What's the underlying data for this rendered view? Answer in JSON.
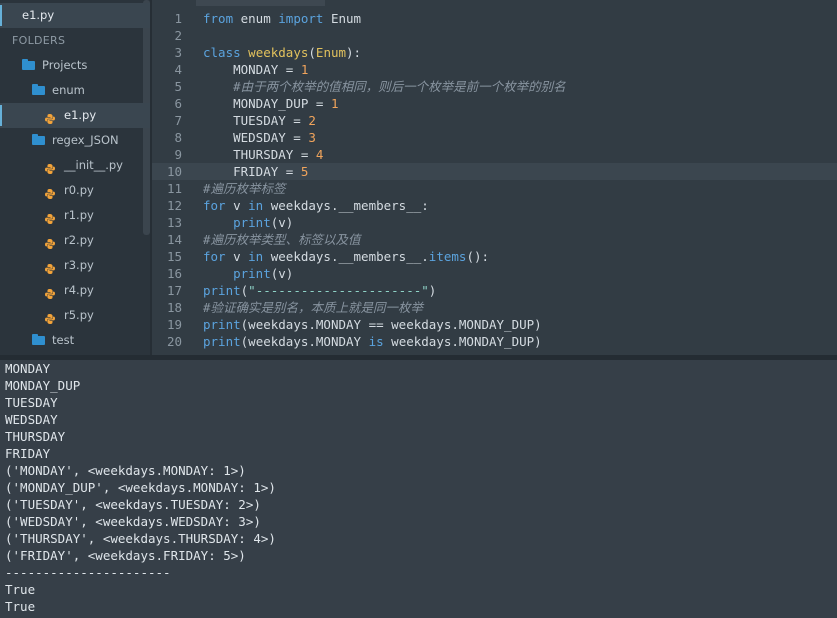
{
  "sidebar": {
    "open_file": "e1.py",
    "folders_header": "FOLDERS",
    "tree": [
      {
        "label": "Projects",
        "type": "folder"
      },
      {
        "label": "enum",
        "type": "folder"
      },
      {
        "label": "e1.py",
        "type": "python"
      },
      {
        "label": "regex_JSON",
        "type": "folder"
      },
      {
        "label": "__init__.py",
        "type": "python"
      },
      {
        "label": "r0.py",
        "type": "python"
      },
      {
        "label": "r1.py",
        "type": "python"
      },
      {
        "label": "r2.py",
        "type": "python"
      },
      {
        "label": "r3.py",
        "type": "python"
      },
      {
        "label": "r4.py",
        "type": "python"
      },
      {
        "label": "r5.py",
        "type": "python"
      },
      {
        "label": "test",
        "type": "folder"
      }
    ]
  },
  "editor": {
    "current_line": 10,
    "lines": [
      {
        "n": "1",
        "t": [
          [
            "kw",
            "from"
          ],
          [
            "op",
            " enum "
          ],
          [
            "kw",
            "import"
          ],
          [
            "op",
            " Enum"
          ]
        ]
      },
      {
        "n": "2",
        "t": []
      },
      {
        "n": "3",
        "t": [
          [
            "kw",
            "class"
          ],
          [
            "op",
            " "
          ],
          [
            "cls",
            "weekdays"
          ],
          [
            "op",
            "("
          ],
          [
            "cls",
            "Enum"
          ],
          [
            "op",
            "):"
          ]
        ]
      },
      {
        "n": "4",
        "t": [
          [
            "op",
            "    MONDAY = "
          ],
          [
            "num",
            "1"
          ]
        ]
      },
      {
        "n": "5",
        "t": [
          [
            "op",
            "    "
          ],
          [
            "cmt",
            "#由于两个枚举的值相同，则后一个枚举是前一个枚举的别名"
          ]
        ]
      },
      {
        "n": "6",
        "t": [
          [
            "op",
            "    MONDAY_DUP = "
          ],
          [
            "num",
            "1"
          ]
        ]
      },
      {
        "n": "7",
        "t": [
          [
            "op",
            "    TUESDAY = "
          ],
          [
            "num",
            "2"
          ]
        ]
      },
      {
        "n": "8",
        "t": [
          [
            "op",
            "    WEDSDAY = "
          ],
          [
            "num",
            "3"
          ]
        ]
      },
      {
        "n": "9",
        "t": [
          [
            "op",
            "    THURSDAY = "
          ],
          [
            "num",
            "4"
          ]
        ]
      },
      {
        "n": "10",
        "t": [
          [
            "op",
            "    FRIDAY = "
          ],
          [
            "num",
            "5"
          ]
        ]
      },
      {
        "n": "11",
        "t": [
          [
            "cmt",
            "#遍历枚举标签"
          ]
        ]
      },
      {
        "n": "12",
        "t": [
          [
            "kw",
            "for"
          ],
          [
            "op",
            " v "
          ],
          [
            "kw",
            "in"
          ],
          [
            "op",
            " weekdays.__members__:"
          ]
        ]
      },
      {
        "n": "13",
        "t": [
          [
            "op",
            "    "
          ],
          [
            "fn",
            "print"
          ],
          [
            "op",
            "(v)"
          ]
        ]
      },
      {
        "n": "14",
        "t": [
          [
            "cmt",
            "#遍历枚举类型、标签以及值"
          ]
        ]
      },
      {
        "n": "15",
        "t": [
          [
            "kw",
            "for"
          ],
          [
            "op",
            " v "
          ],
          [
            "kw",
            "in"
          ],
          [
            "op",
            " weekdays.__members__."
          ],
          [
            "meth",
            "items"
          ],
          [
            "op",
            "():"
          ]
        ]
      },
      {
        "n": "16",
        "t": [
          [
            "op",
            "    "
          ],
          [
            "fn",
            "print"
          ],
          [
            "op",
            "(v)"
          ]
        ]
      },
      {
        "n": "17",
        "t": [
          [
            "fn",
            "print"
          ],
          [
            "op",
            "("
          ],
          [
            "str",
            "\"----------------------\""
          ],
          [
            "op",
            ")"
          ]
        ]
      },
      {
        "n": "18",
        "t": [
          [
            "cmt",
            "#验证确实是别名，本质上就是同一枚举"
          ]
        ]
      },
      {
        "n": "19",
        "t": [
          [
            "fn",
            "print"
          ],
          [
            "op",
            "(weekdays.MONDAY == weekdays.MONDAY_DUP)"
          ]
        ]
      },
      {
        "n": "20",
        "t": [
          [
            "fn",
            "print"
          ],
          [
            "op",
            "(weekdays.MONDAY "
          ],
          [
            "kw",
            "is"
          ],
          [
            "op",
            " weekdays.MONDAY_DUP)"
          ]
        ]
      }
    ]
  },
  "output": {
    "lines": [
      "MONDAY",
      "MONDAY_DUP",
      "TUESDAY",
      "WEDSDAY",
      "THURSDAY",
      "FRIDAY",
      "('MONDAY', <weekdays.MONDAY: 1>)",
      "('MONDAY_DUP', <weekdays.MONDAY: 1>)",
      "('TUESDAY', <weekdays.TUESDAY: 2>)",
      "('WEDSDAY', <weekdays.WEDSDAY: 3>)",
      "('THURSDAY', <weekdays.THURSDAY: 4>)",
      "('FRIDAY', <weekdays.FRIDAY: 5>)",
      "----------------------",
      "True",
      "True"
    ]
  },
  "colors": {
    "folder": "#2f8fcf",
    "python_icon": "#f2a33a",
    "keyword": "#5ba3de",
    "class_name": "#e1c15d",
    "number": "#f0a45c",
    "comment": "#8894a0"
  }
}
